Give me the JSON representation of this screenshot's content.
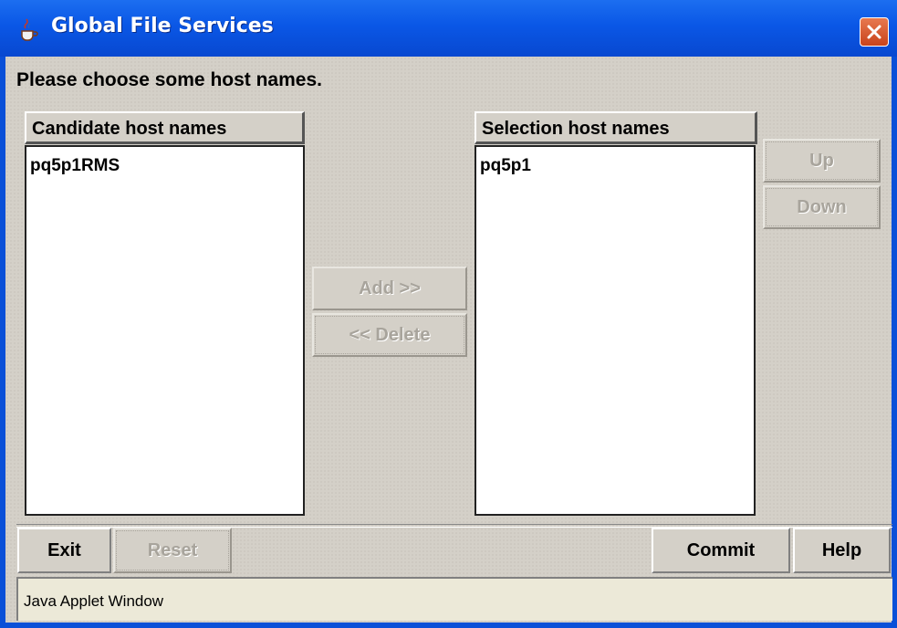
{
  "window": {
    "title": "Global File Services",
    "title_icon": "java-coffee-icon",
    "close_icon": "close-icon",
    "accent_color": "#0a50d8",
    "close_color": "#d84a1e"
  },
  "prompt": "Please choose some host names.",
  "candidate": {
    "header": "Candidate host names",
    "items": [
      "pq5p1RMS"
    ]
  },
  "selection": {
    "header": "Selection host names",
    "items": [
      "pq5p1"
    ]
  },
  "buttons": {
    "add": "Add >>",
    "delete": "<< Delete",
    "up": "Up",
    "down": "Down",
    "exit": "Exit",
    "reset": "Reset",
    "commit": "Commit",
    "help": "Help"
  },
  "status_bar": "Java Applet Window"
}
